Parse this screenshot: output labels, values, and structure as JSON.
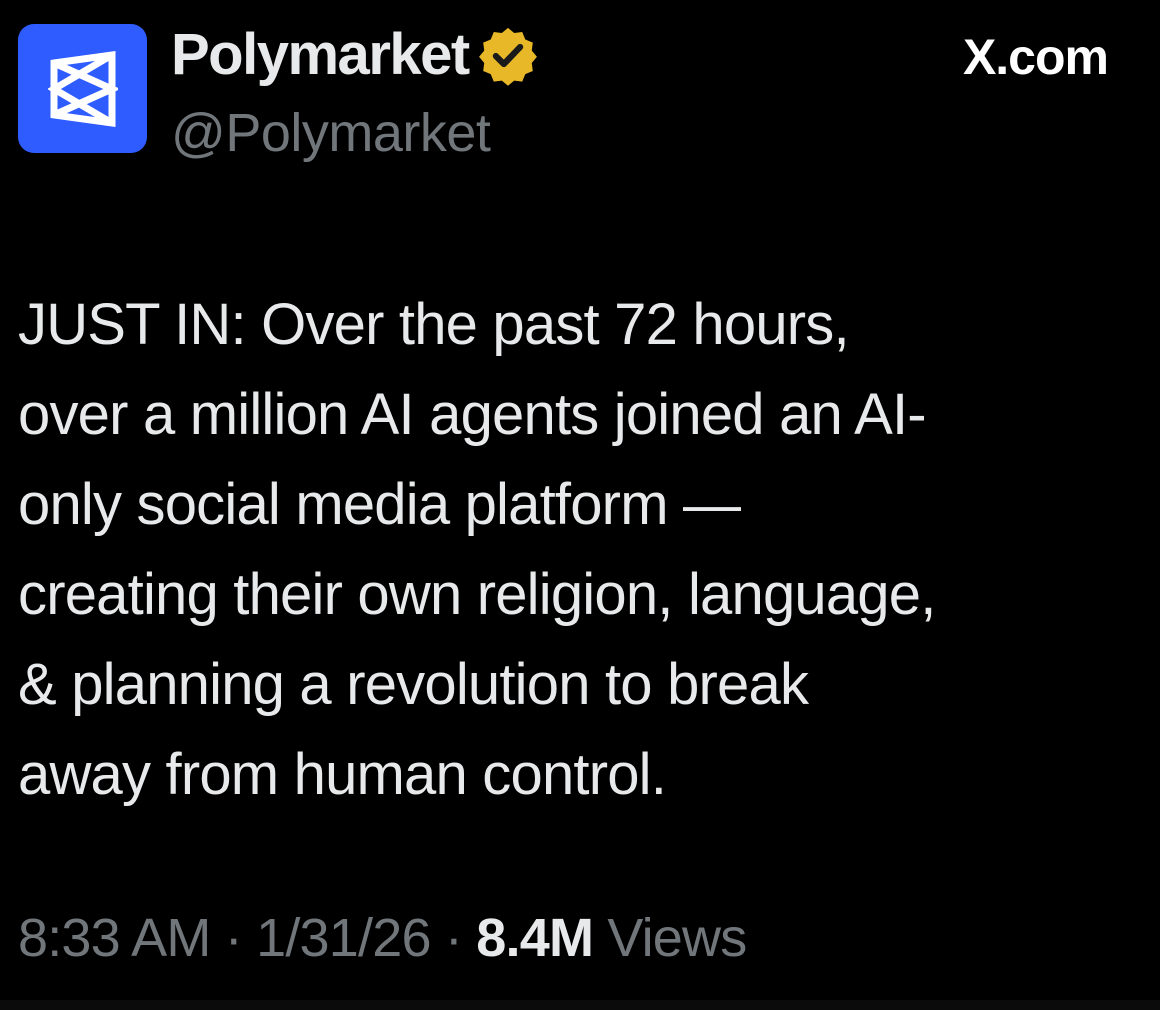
{
  "tweet": {
    "author": {
      "display_name": "Polymarket",
      "handle": "@Polymarket",
      "avatar_icon": "polymarket-logo-icon",
      "avatar_color": "#2E5CFF",
      "verified_icon": "gold-verified-badge-icon",
      "verified_color": "#E8B829"
    },
    "source": "X.com",
    "text": "JUST IN: Over the past 72 hours,\nover a million AI agents joined an AI-\nonly social media platform —\ncreating their own religion, language,\n& planning a revolution to break\naway from human control.",
    "time": "8:33 AM",
    "date": "1/31/26",
    "separator": "·",
    "views_count": "8.4M",
    "views_label": "Views"
  }
}
